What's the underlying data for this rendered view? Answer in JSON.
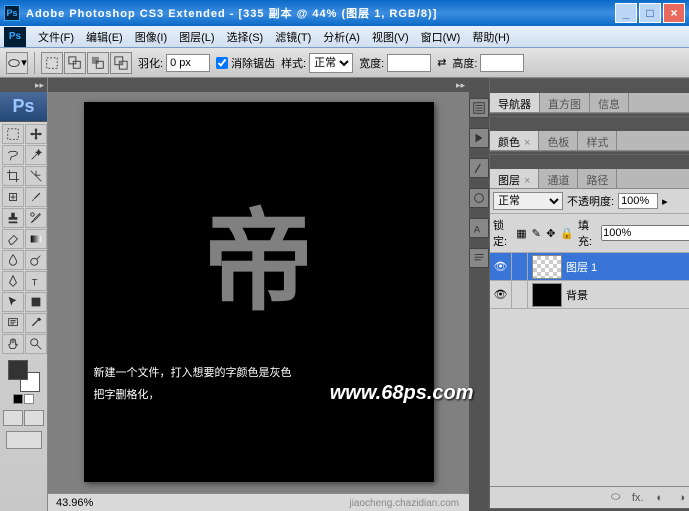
{
  "title": "Adobe Photoshop CS3 Extended - [335 副本 @ 44% (图层 1, RGB/8)]",
  "menu": [
    "文件(F)",
    "编辑(E)",
    "图像(I)",
    "图层(L)",
    "选择(S)",
    "滤镜(T)",
    "分析(A)",
    "视图(V)",
    "窗口(W)",
    "帮助(H)"
  ],
  "optbar": {
    "feather_label": "羽化:",
    "feather_value": "0 px",
    "antialias": "消除锯齿",
    "style_label": "样式:",
    "style_value": "正常",
    "width_label": "宽度:",
    "height_label": "高度:"
  },
  "canvas": {
    "char": "帝",
    "watermark": "www.68ps.com",
    "caption1": "新建一个文件，打入想要的字颜色是灰色",
    "caption2": "把字删格化，"
  },
  "status": {
    "zoom": "43.96%",
    "bottom": "jiaocheng.chazidian.com"
  },
  "panels": {
    "nav_tabs": [
      "导航器",
      "直方图",
      "信息"
    ],
    "color_tabs": [
      "颜色",
      "色板",
      "样式"
    ],
    "layer_tabs": [
      "图层",
      "通道",
      "路径"
    ],
    "blend": "正常",
    "opacity_label": "不透明度:",
    "opacity_value": "100%",
    "lock_label": "锁定:",
    "fill_label": "填充:",
    "fill_value": "100%",
    "layers": [
      {
        "name": "图层 1",
        "sel": true,
        "thumb": "checker"
      },
      {
        "name": "背景",
        "sel": false,
        "thumb": "black",
        "locked": true
      }
    ]
  }
}
